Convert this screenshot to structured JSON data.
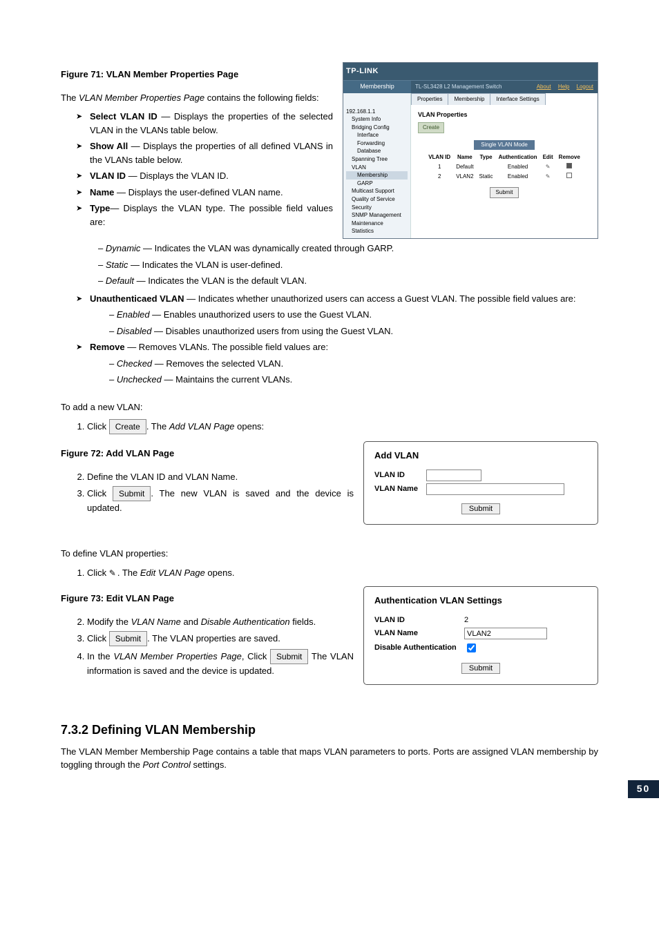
{
  "fig71": {
    "caption": "Figure 71: VLAN Member Properties Page",
    "intro": "The VLAN Member Properties Page contains the following fields:",
    "bullets": [
      {
        "b": "Select VLAN ID",
        "t": " — Displays the properties of the selected VLAN in the VLANs table below."
      },
      {
        "b": "Show All",
        "t": " — Displays the properties of all defined VLANS in the VLANs table below."
      },
      {
        "b": "VLAN ID",
        "t": " — Displays the VLAN ID."
      },
      {
        "b": "Name",
        "t": " — Displays the user-defined VLAN name."
      },
      {
        "b": "Type",
        "t": "— Displays the VLAN type. The possible field values are:"
      }
    ],
    "type_sub": [
      {
        "i": "Dynamic",
        "t": " — Indicates the VLAN was dynamically created through GARP."
      },
      {
        "i": "Static",
        "t": " — Indicates the VLAN is user-defined."
      },
      {
        "i": "Default",
        "t": " — Indicates the VLAN is the default VLAN."
      }
    ],
    "bullets2": [
      {
        "b": "Unauthenticaed VLAN",
        "t": " — Indicates whether unauthorized users can access a Guest VLAN. The possible field values are:"
      }
    ],
    "unauth_sub": [
      {
        "i": "Enabled",
        "t": " — Enables unauthorized users to use the Guest VLAN."
      },
      {
        "i": "Disabled",
        "t": " — Disables unauthorized users from using the Guest VLAN."
      }
    ],
    "bullets3": [
      {
        "b": "Remove",
        "t": " — Removes VLANs. The possible field values are:"
      }
    ],
    "remove_sub": [
      {
        "i": "Checked",
        "t": " — Removes the selected VLAN."
      },
      {
        "i": "Unchecked",
        "t": " — Maintains the current VLANs."
      }
    ],
    "shot": {
      "brand": "TP-LINK",
      "sidelabel": "Membership",
      "device": "TL-SL3428 L2 Management Switch",
      "links": {
        "about": "About",
        "help": "Help",
        "logout": "Logout"
      },
      "tabs": [
        "Properties",
        "Membership",
        "Interface Settings"
      ],
      "tree": [
        "192.168.1.1",
        "System Info",
        "Bridging Config",
        "Interface",
        "Forwarding Database",
        "Spanning Tree",
        "VLAN",
        "Membership",
        "GARP",
        "Multicast Support",
        "Quality of Service",
        "Security",
        "SNMP Management",
        "Maintenance",
        "Statistics"
      ],
      "section": "VLAN Properties",
      "create": "Create",
      "mode": "Single VLAN Mode",
      "cols": [
        "VLAN ID",
        "Name",
        "Type",
        "Authentication",
        "Edit",
        "Remove"
      ],
      "rows": [
        {
          "id": "1",
          "name": "Default",
          "type": "",
          "auth": "Enabled"
        },
        {
          "id": "2",
          "name": "VLAN2",
          "type": "Static",
          "auth": "Enabled"
        }
      ],
      "submit": "Submit"
    }
  },
  "add_vlan_steps": {
    "intro": "To add a new VLAN:",
    "s1_pre": "Click ",
    "s1_btn": "Create",
    "s1_post": ". The Add VLAN Page opens:"
  },
  "fig72": {
    "caption": "Figure 72: Add VLAN Page",
    "s2": "Define the VLAN ID and VLAN Name.",
    "s3_pre": "Click ",
    "s3_btn": "Submit",
    "s3_post": ". The new VLAN is saved and the device is updated.",
    "panel": {
      "title": "Add VLAN",
      "vlan_id_label": "VLAN ID",
      "vlan_name_label": "VLAN Name",
      "submit": "Submit"
    }
  },
  "edit_vlan_steps": {
    "intro": "To define VLAN properties:",
    "s1_pre": "Click ",
    "s1_post": " . The Edit VLAN Page opens."
  },
  "fig73": {
    "caption": "Figure 73: Edit VLAN Page",
    "s2_pre": "Modify the ",
    "s2_i1": "VLAN Name",
    "s2_mid": " and ",
    "s2_i2": "Disable Authentication",
    "s2_post": " fields.",
    "s3_pre": "Click ",
    "s3_btn": "Submit",
    "s3_post": ". The VLAN properties are saved.",
    "s4_pre": "In the ",
    "s4_i": "VLAN Member Properties Page",
    "s4_mid": ", Click ",
    "s4_btn": "Submit",
    "s4_post": " The VLAN information is saved and the device is updated.",
    "panel": {
      "title": "Authentication VLAN Settings",
      "vlan_id_label": "VLAN ID",
      "vlan_id_value": "2",
      "vlan_name_label": "VLAN Name",
      "vlan_name_value": "VLAN2",
      "disable_auth_label": "Disable Authentication",
      "submit": "Submit"
    }
  },
  "sect732": {
    "heading": "7.3.2  Defining VLAN Membership",
    "para_pre": "The VLAN Member Membership Page contains a table that maps VLAN parameters to ports. Ports are assigned VLAN membership by toggling through the ",
    "para_i": "Port Control",
    "para_post": " settings."
  },
  "page_number": "50"
}
